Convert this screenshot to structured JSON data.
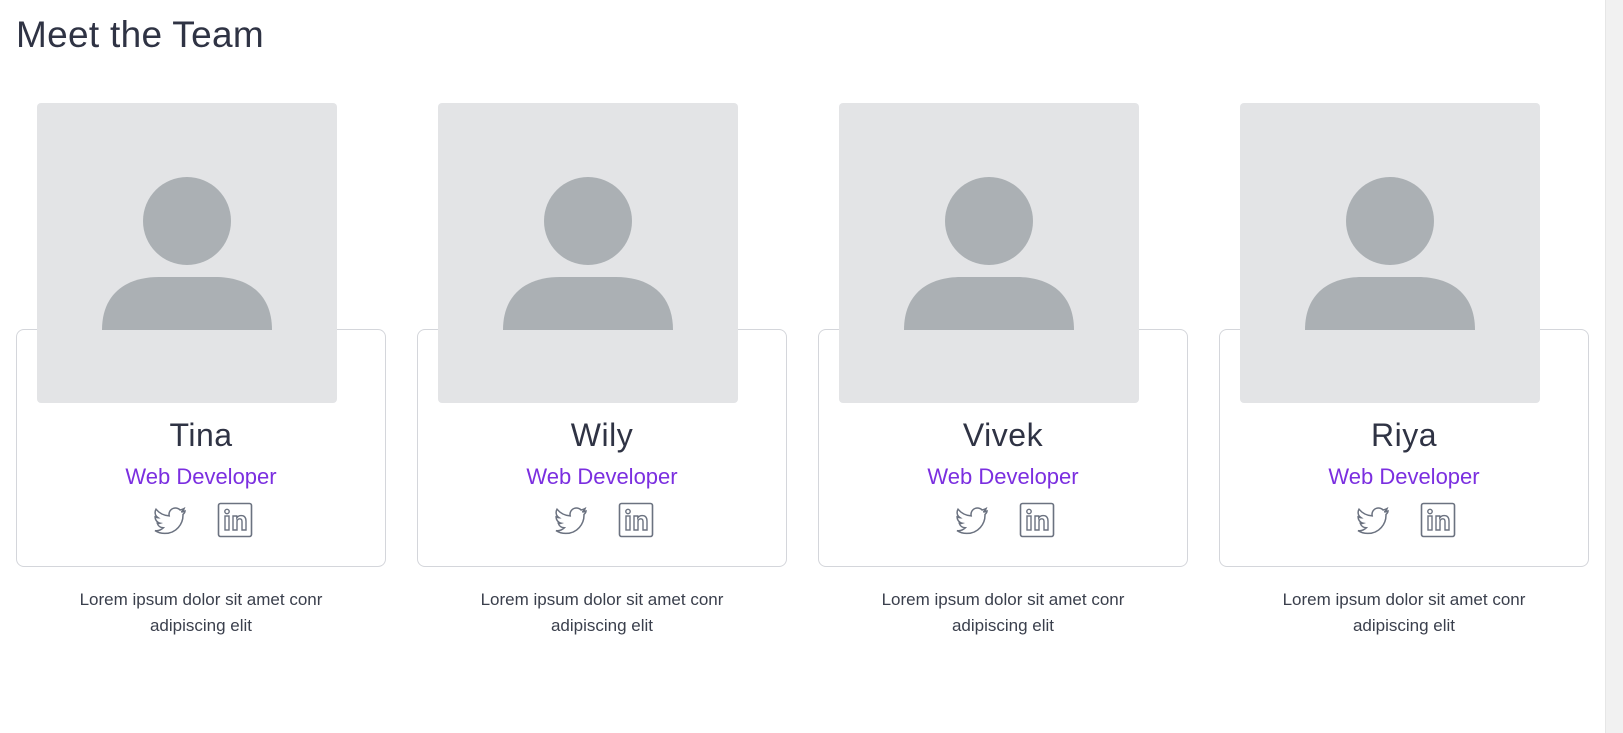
{
  "page": {
    "title": "Meet the Team"
  },
  "members": [
    {
      "name": "Tina",
      "role": "Web Developer",
      "bio_line1": "Lorem ipsum dolor sit amet conr",
      "bio_line2": "adipiscing elit"
    },
    {
      "name": "Wily",
      "role": "Web Developer",
      "bio_line1": "Lorem ipsum dolor sit amet conr",
      "bio_line2": "adipiscing elit"
    },
    {
      "name": "Vivek",
      "role": "Web Developer",
      "bio_line1": "Lorem ipsum dolor sit amet conr",
      "bio_line2": "adipiscing elit"
    },
    {
      "name": "Riya",
      "role": "Web Developer",
      "bio_line1": "Lorem ipsum dolor sit amet conr",
      "bio_line2": "adipiscing elit"
    }
  ],
  "icons": {
    "avatar": "user-placeholder-icon",
    "twitter": "twitter-icon",
    "linkedin": "linkedin-icon"
  },
  "colors": {
    "accent": "#7b2fe0",
    "text": "#2f3344",
    "photo_bg": "#e3e4e6",
    "avatar_fill": "#abb0b4",
    "icon_stroke": "#6b7280"
  }
}
